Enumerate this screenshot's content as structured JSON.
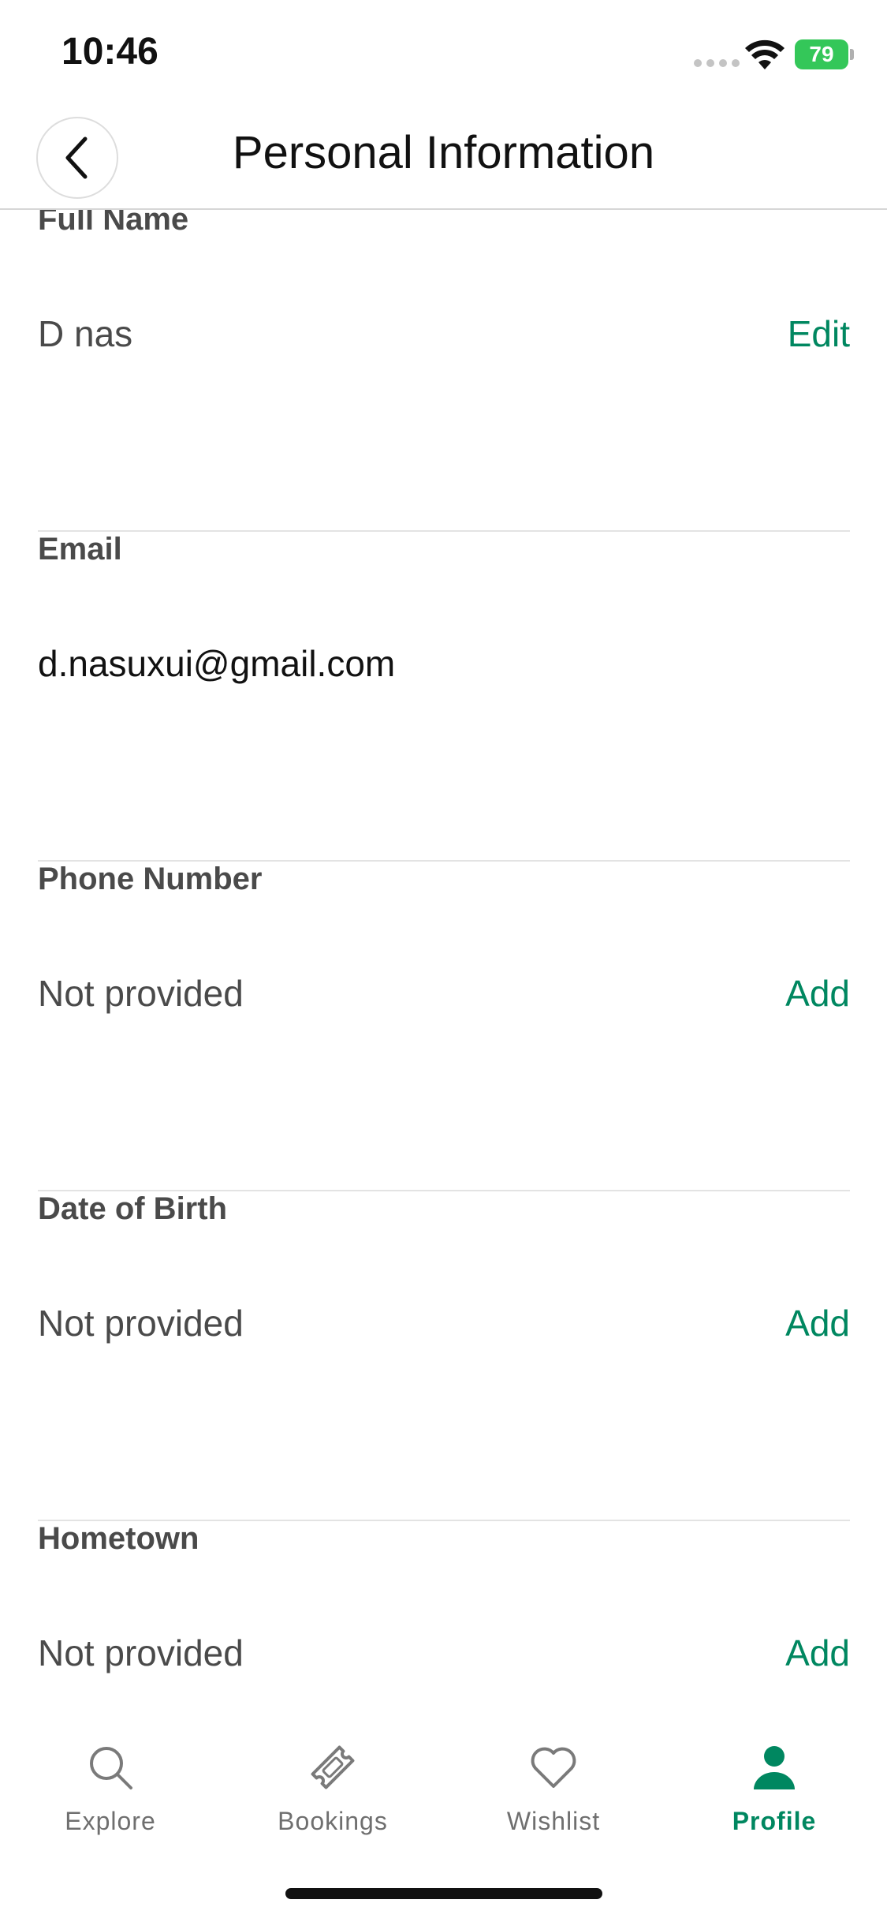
{
  "status_bar": {
    "time": "10:46",
    "battery": "79",
    "battery_color": "#34c759"
  },
  "header": {
    "title": "Personal Information",
    "back_icon": "chevron-left-icon"
  },
  "fields": [
    {
      "label": "Full Name",
      "value": "D nas",
      "action": "Edit"
    },
    {
      "label": "Email",
      "value": "d.nasuxui@gmail.com",
      "action": ""
    },
    {
      "label": "Phone Number",
      "value": "Not provided",
      "action": "Add"
    },
    {
      "label": "Date of Birth",
      "value": "Not provided",
      "action": "Add"
    },
    {
      "label": "Hometown",
      "value": "Not provided",
      "action": "Add"
    }
  ],
  "tab_bar": {
    "tabs": [
      {
        "label": "Explore",
        "icon": "search-icon",
        "active": false
      },
      {
        "label": "Bookings",
        "icon": "ticket-icon",
        "active": false
      },
      {
        "label": "Wishlist",
        "icon": "heart-icon",
        "active": false
      },
      {
        "label": "Profile",
        "icon": "person-icon",
        "active": true
      }
    ]
  },
  "colors": {
    "accent": "#008760",
    "label": "#4a4a4a",
    "divider": "#e3e3e3"
  }
}
